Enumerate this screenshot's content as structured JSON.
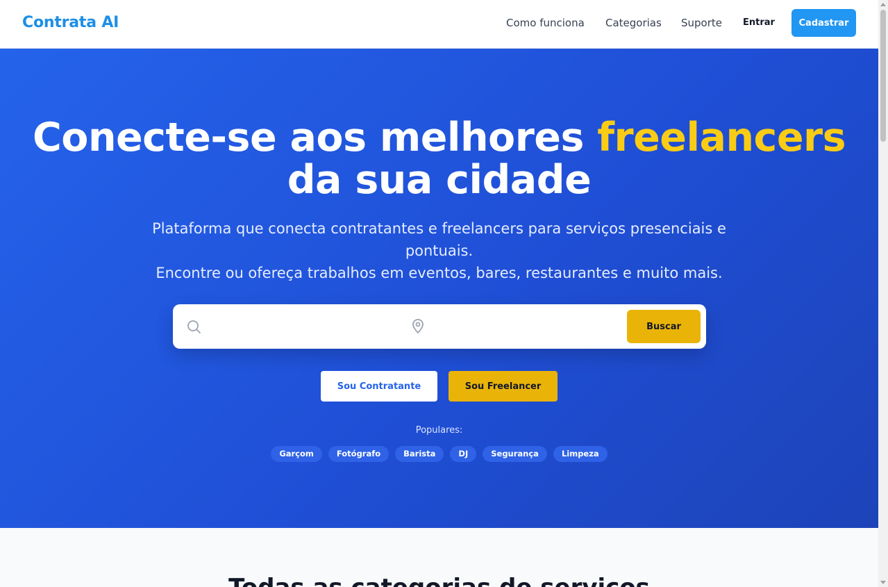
{
  "header": {
    "logo": "Contrata AI",
    "nav": [
      "Como funciona",
      "Categorias",
      "Suporte"
    ],
    "login_label": "Entrar",
    "signup_label": "Cadastrar"
  },
  "hero": {
    "title_before": "Conecte-se aos melhores ",
    "title_highlight": "freelancers",
    "title_after": " da sua cidade",
    "subtitle_line1": "Plataforma que conecta contratantes e freelancers para serviços presenciais e pontuais.",
    "subtitle_line2": "Encontre ou ofereça trabalhos em eventos, bares, restaurantes e muito mais.",
    "search": {
      "query_value": "",
      "location_value": "",
      "button_label": "Buscar"
    },
    "cta_contratante": "Sou Contratante",
    "cta_freelancer": "Sou Freelancer",
    "popular_label": "Populares:",
    "popular_tags": [
      "Garçom",
      "Fotógrafo",
      "Barista",
      "DJ",
      "Segurança",
      "Limpeza"
    ]
  },
  "categories_section": {
    "title": "Todas as categorias de serviços"
  },
  "colors": {
    "brand": "#1d8fe6",
    "hero_blue": "#2563eb",
    "accent_yellow": "#eab308",
    "highlight_yellow": "#facc15"
  },
  "icons": {
    "search": "search-icon",
    "location": "map-pin-icon"
  }
}
